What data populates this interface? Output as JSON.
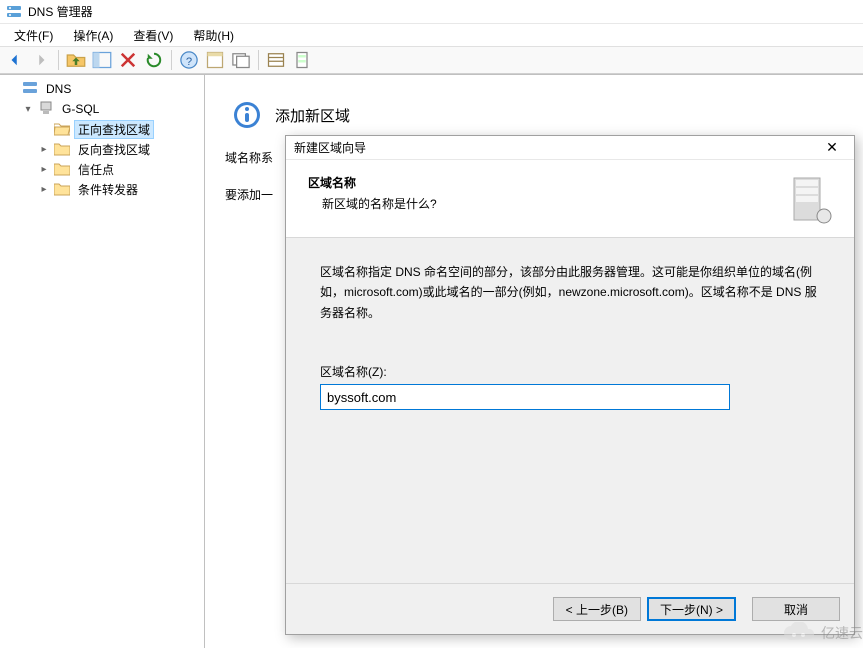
{
  "window": {
    "title": "DNS 管理器"
  },
  "menu": {
    "file": "文件(F)",
    "action": "操作(A)",
    "view": "查看(V)",
    "help": "帮助(H)"
  },
  "tree": {
    "root_label": "DNS",
    "server_label": "G-SQL",
    "nodes": {
      "forward": "正向查找区域",
      "reverse": "反向查找区域",
      "trust": "信任点",
      "forwarders": "条件转发器"
    }
  },
  "content": {
    "heading": "添加新区域",
    "line1_prefix": "域名称系",
    "line2_prefix": "要添加一"
  },
  "wizard": {
    "title": "新建区域向导",
    "header_title": "区域名称",
    "header_sub": "新区域的名称是什么?",
    "description": "区域名称指定 DNS 命名空间的部分，该部分由此服务器管理。这可能是你组织单位的域名(例如，microsoft.com)或此域名的一部分(例如，newzone.microsoft.com)。区域名称不是 DNS 服务器名称。",
    "field_label": "区域名称(Z):",
    "field_value": "byssoft.com",
    "btn_back": "< 上一步(B)",
    "btn_next": "下一步(N) >",
    "btn_cancel": "取消"
  },
  "watermark": {
    "text": "亿速云"
  }
}
